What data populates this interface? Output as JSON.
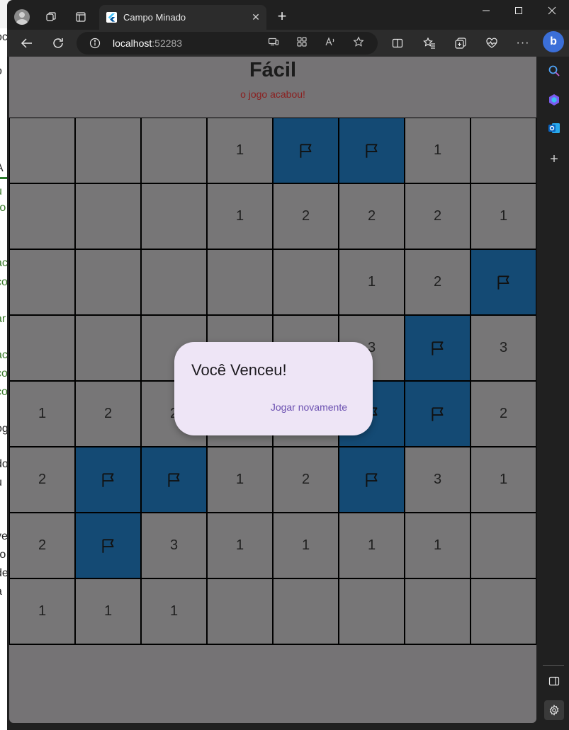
{
  "background_page": {
    "fragments": [
      "oc",
      "oc",
      "o",
      "A",
      "u",
      "ro",
      "r",
      "ac",
      "co",
      "ar",
      "ac",
      "co",
      "co",
      "og",
      "do",
      "u",
      "ve",
      "ro",
      "de",
      "a"
    ]
  },
  "browser": {
    "tab": {
      "title": "Campo Minado"
    },
    "address": {
      "host": "localhost",
      "port": ":52283"
    },
    "icons": {
      "avatar": "profile-avatar",
      "workspaces": "workspaces-icon",
      "tab_actions": "tab-actions-icon",
      "new_tab": "plus-icon",
      "minimize": "minimize-icon",
      "maximize": "maximize-icon",
      "close": "close-icon",
      "back": "back-arrow-icon",
      "refresh": "refresh-icon",
      "info": "info-icon",
      "app_available": "app-available-icon",
      "read_aloud": "read-aloud-icon",
      "favorite": "star-icon",
      "split_screen": "split-screen-icon",
      "favorites": "favorites-icon",
      "collections": "collections-icon",
      "health": "browser-essentials-icon",
      "more": "more-icon",
      "copilot": "copilot-icon"
    },
    "labels": {
      "new_tab": "+",
      "close_tab": "✕",
      "more": "···",
      "bing": "b"
    }
  },
  "sidebar": {
    "items": [
      "search-icon",
      "copilot-icon",
      "outlook-icon",
      "add-icon",
      "hide-sidebar-icon",
      "settings-icon"
    ],
    "add_label": "+"
  },
  "game": {
    "title": "Fácil",
    "subtitle": "o jogo acabou!",
    "colors": {
      "cell": "#777677",
      "flag": "#144a74",
      "grid_line": "#000000",
      "subtitle": "#8b1f1f"
    },
    "board": [
      [
        "",
        "",
        "",
        "1",
        "F",
        "F",
        "1",
        ""
      ],
      [
        "",
        "",
        "",
        "1",
        "2",
        "2",
        "2",
        "1"
      ],
      [
        "",
        "",
        "",
        "",
        "",
        "1",
        "2",
        "F"
      ],
      [
        "",
        "",
        "",
        "",
        "",
        "3",
        "F",
        "3"
      ],
      [
        "1",
        "2",
        "2",
        "",
        "",
        "F",
        "F",
        "2"
      ],
      [
        "2",
        "F",
        "F",
        "1",
        "2",
        "F",
        "3",
        "1"
      ],
      [
        "2",
        "F",
        "3",
        "1",
        "1",
        "1",
        "1",
        ""
      ],
      [
        "1",
        "1",
        "1",
        "",
        "",
        "",
        "",
        ""
      ]
    ]
  },
  "dialog": {
    "title": "Você Venceu!",
    "action": "Jogar novamente"
  }
}
